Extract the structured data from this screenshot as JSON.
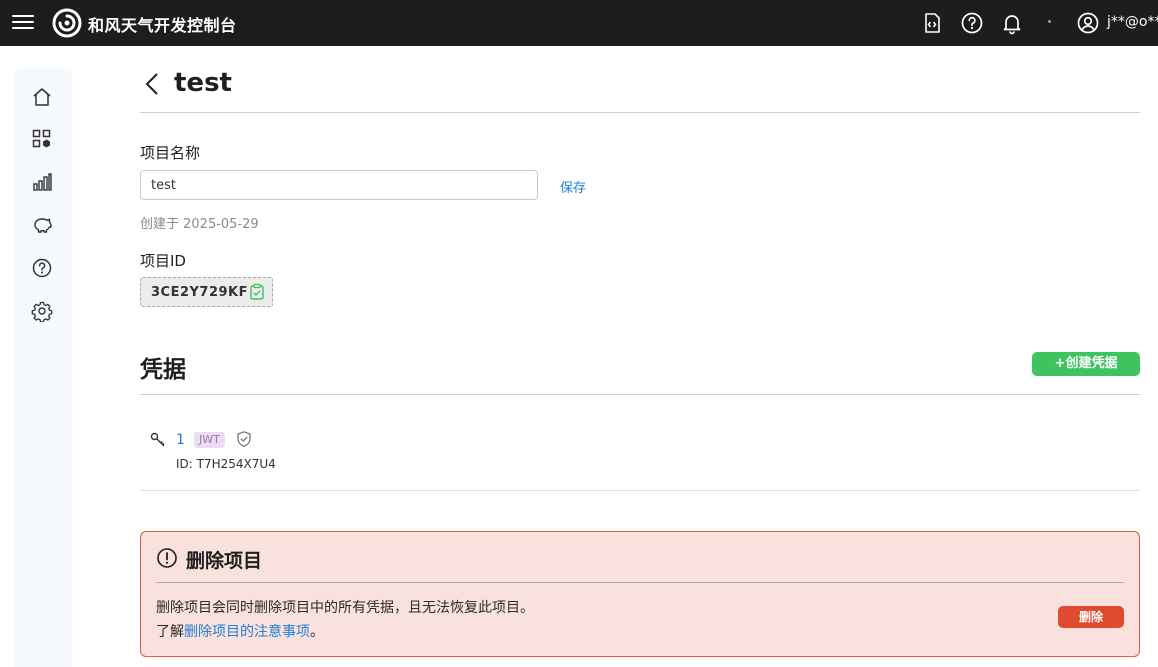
{
  "topbar": {
    "brand": "和风天气开发控制台",
    "user": "j**@o**.",
    "icons": [
      "menu-icon",
      "code-doc-icon",
      "help-icon",
      "bell-icon",
      "user-icon"
    ]
  },
  "sidebar": {
    "items": [
      {
        "name": "home",
        "icon": "home-icon"
      },
      {
        "name": "projects",
        "icon": "apps-icon"
      },
      {
        "name": "stats",
        "icon": "bar-chart-icon"
      },
      {
        "name": "billing",
        "icon": "piggy-bank-icon"
      },
      {
        "name": "help",
        "icon": "help-icon"
      },
      {
        "name": "settings",
        "icon": "gear-icon"
      }
    ]
  },
  "page": {
    "title": "test"
  },
  "project": {
    "name_label": "项目名称",
    "name_value": "test",
    "save_label": "保存",
    "created": "创建于 2025-05-29",
    "id_label": "项目ID",
    "id_value": "3CE2Y729KF"
  },
  "credentials": {
    "title": "凭据",
    "create_label": "+创建凭据",
    "items": [
      {
        "name": "1",
        "type": "JWT",
        "id": "ID: T7H254X7U4"
      }
    ]
  },
  "danger": {
    "title": "删除项目",
    "line1": "删除项目会同时删除项目中的所有凭据，且无法恢复此项目。",
    "line2_prefix": "了解",
    "line2_link": "删除项目的注意事项",
    "line2_suffix": "。",
    "delete_label": "删除"
  },
  "colors": {
    "topbar": "#1d1d1d",
    "link": "#1e7fd8",
    "create": "#3ec45f",
    "danger_bg": "#f9e2dd",
    "danger_border": "#e05a42",
    "delete": "#e04a2e"
  }
}
